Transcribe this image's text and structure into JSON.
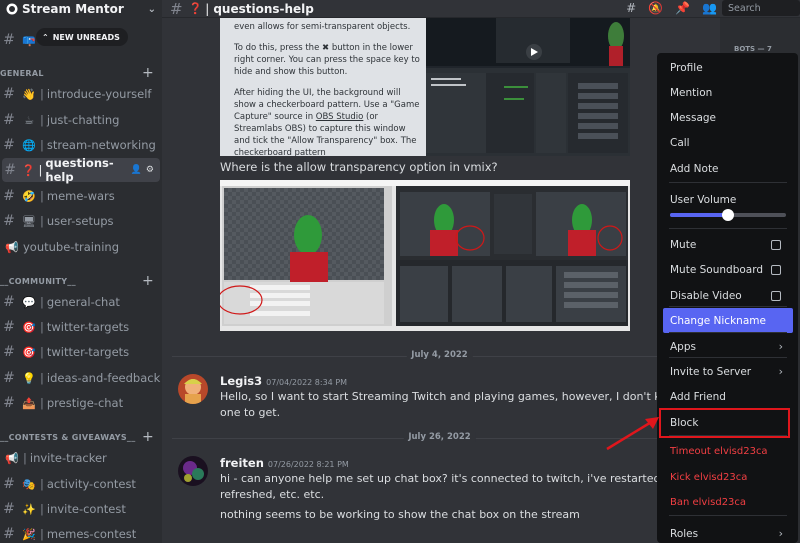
{
  "server": {
    "name": "Stream Mentor"
  },
  "new_unreads": "NEW UNREADS",
  "categories": [
    {
      "label": "GENERAL"
    },
    {
      "label": "__COMMUNITY__"
    },
    {
      "label": "__CONTESTS & GIVEAWAYS__"
    }
  ],
  "channels": [
    {
      "emoji": "👋",
      "name": "introduce-yourself"
    },
    {
      "emoji": "☕",
      "name": "just-chatting"
    },
    {
      "emoji": "🌐",
      "name": "stream-networking"
    },
    {
      "emoji": "❓",
      "name": "questions-help"
    },
    {
      "emoji": "🤣",
      "name": "meme-wars"
    },
    {
      "emoji": "🖥",
      "name": "user-setups"
    },
    {
      "emoji": "📢",
      "name": "youtube-training"
    },
    {
      "emoji": "💬",
      "name": "general-chat"
    },
    {
      "emoji": "🎯",
      "name": "twitter-targets"
    },
    {
      "emoji": "🎯",
      "name": "twitter-targets"
    },
    {
      "emoji": "💡",
      "name": "ideas-and-feedback"
    },
    {
      "emoji": "📤",
      "name": "prestige-chat"
    },
    {
      "emoji": "📢",
      "name": "invite-tracker"
    },
    {
      "emoji": "🎭",
      "name": "activity-contest"
    },
    {
      "emoji": "✨",
      "name": "invite-contest"
    },
    {
      "emoji": "🎉",
      "name": "memes-contest"
    }
  ],
  "topbar": {
    "emoji": "❓",
    "title": "questions-help",
    "search_placeholder": "Search"
  },
  "embed_text": {
    "p1": "even allows for semi-transparent objects.",
    "p2": "To do this, press the ✖ button in the lower right corner. You can press the space key to hide and show this button.",
    "p3a": "After hiding the UI, the background will show a checkerboard pattern. Use a \"Game Capture\" source in ",
    "p3link1": "OBS Studio",
    "p3b": " (or Streamlabs OBS) to capture this window and tick the \"Allow Transparency\" box. The checkerboard pattern"
  },
  "question_text": "Where is the  allow transparency option in vmix?",
  "dates": {
    "d1": "July 4, 2022",
    "d2": "July 26, 2022"
  },
  "messages": [
    {
      "user": "Legis3",
      "timestamp": "07/04/2022 8:34 PM",
      "lines": [
        "Hello, so I want to start Streaming Twitch and playing games, however, I don't know whi",
        "one to get."
      ]
    },
    {
      "user": "freiten",
      "timestamp": "07/26/2022 8:21 PM",
      "lines": [
        "hi - can anyone help me set up chat box? it's connected to twitch, i've restarted,",
        "refreshed, etc. etc.",
        "nothing seems to be working to show the chat box on the stream"
      ]
    }
  ],
  "member_list": {
    "role_label": "BOTS — 7"
  },
  "context_menu": {
    "profile": "Profile",
    "mention": "Mention",
    "message": "Message",
    "call": "Call",
    "add_note": "Add Note",
    "user_volume": "User Volume",
    "user_volume_level": 0.5,
    "mute": "Mute",
    "mute_soundboard": "Mute Soundboard",
    "disable_video": "Disable Video",
    "change_nickname": "Change Nickname",
    "apps": "Apps",
    "invite_to_server": "Invite to Server",
    "add_friend": "Add Friend",
    "block": "Block",
    "timeout": "Timeout elvisd23ca",
    "kick": "Kick elvisd23ca",
    "ban": "Ban elvisd23ca",
    "roles": "Roles"
  },
  "colors": {
    "accent": "#5865f2",
    "danger": "#f23f43",
    "annotation": "#e0161c"
  }
}
